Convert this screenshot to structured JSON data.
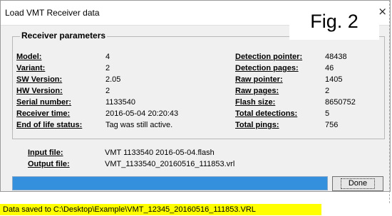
{
  "window": {
    "title": "Load VMT Receiver data",
    "close_glyph": "×"
  },
  "figure_label": "Fig. 2",
  "group": {
    "title": "Receiver parameters"
  },
  "left_params": [
    {
      "label": "Model:",
      "value": "4"
    },
    {
      "label": "Variant:",
      "value": "2"
    },
    {
      "label": "SW Version:",
      "value": "2.05"
    },
    {
      "label": "HW Version:",
      "value": "2"
    },
    {
      "label": "Serial number:",
      "value": "1133540"
    },
    {
      "label": "Receiver time:",
      "value": "2016-05-04 20:20:43"
    },
    {
      "label": "End of life status:",
      "value": "Tag was still active."
    }
  ],
  "right_params": [
    {
      "label": "Detection pointer:",
      "value": "48438"
    },
    {
      "label": "Detection pages:",
      "value": "46"
    },
    {
      "label": "Raw pointer:",
      "value": "1405"
    },
    {
      "label": "Raw pages:",
      "value": "2"
    },
    {
      "label": "Flash size:",
      "value": "8650752"
    },
    {
      "label": "Total detections:",
      "value": "5"
    },
    {
      "label": "Total pings:",
      "value": "756"
    }
  ],
  "files": {
    "input_label": "Input file:",
    "input_value": "VMT 1133540 2016-05-04.flash",
    "output_label": "Output file:",
    "output_value": "VMT_1133540_20160516_111853.vrl"
  },
  "progress": {
    "fraction": 1.0,
    "color": "#3490dc"
  },
  "done_label": "Done",
  "status_message": "Data saved to C:\\Desktop\\Example\\VMT_12345_20160516_111853.VRL",
  "colors": {
    "status_highlight": "#ffff00",
    "progress_fill": "#3490dc"
  }
}
